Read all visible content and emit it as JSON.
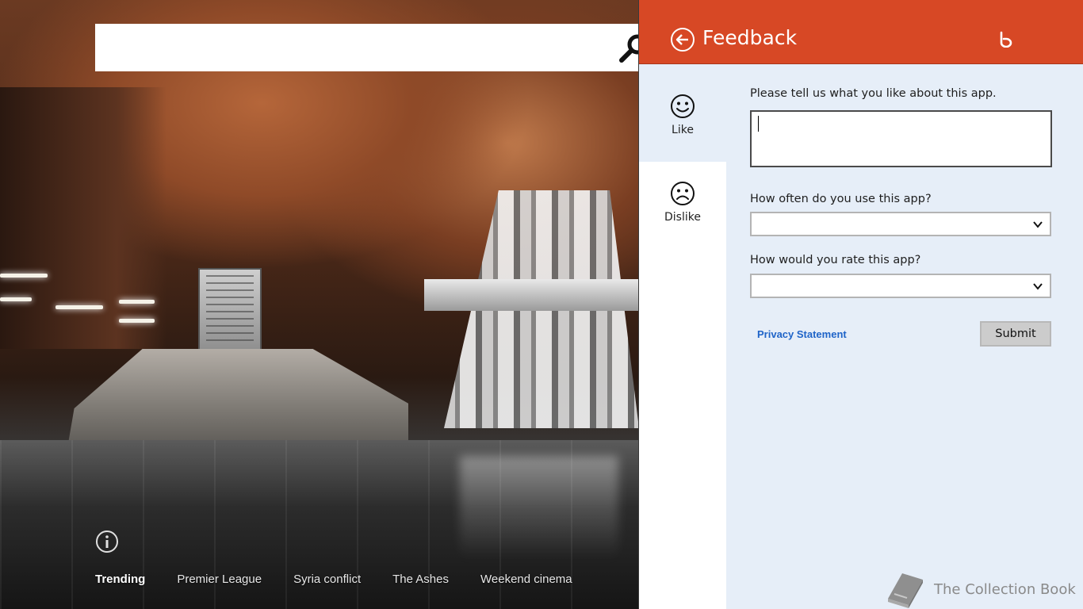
{
  "search": {
    "placeholder": ""
  },
  "trending": {
    "items": [
      "Trending",
      "Premier League",
      "Syria conflict",
      "The Ashes",
      "Weekend cinema"
    ]
  },
  "feedback": {
    "title": "Feedback",
    "nav": {
      "like": "Like",
      "dislike": "Dislike"
    },
    "questions": {
      "like_prompt": "Please tell us what you like about this app.",
      "frequency": "How often do you use this app?",
      "rating": "How would you rate this app?"
    },
    "comment_value": "",
    "frequency_value": "",
    "rating_value": "",
    "privacy_link": "Privacy Statement",
    "submit_label": "Submit"
  },
  "watermark": {
    "text": "The Collection Book"
  },
  "colors": {
    "header": "#d74825",
    "pane_bg": "#e6eef8",
    "link": "#1f64c8",
    "submit_bg": "#cccccc"
  },
  "icons": {
    "search": "search-icon",
    "info": "info-icon",
    "back": "back-arrow-icon",
    "bing": "bing-logo-icon",
    "like": "smiley-face-icon",
    "dislike": "frown-face-icon",
    "chevron": "chevron-down-icon",
    "book": "book-icon"
  }
}
